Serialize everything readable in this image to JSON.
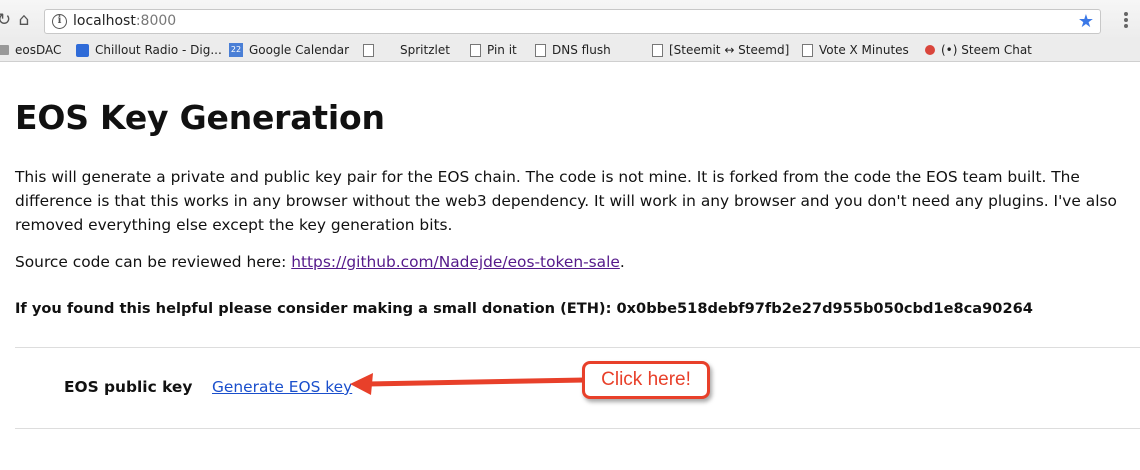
{
  "browser": {
    "url_host": "localhost",
    "url_port": ":8000",
    "bookmarks": [
      {
        "label": "eosDAC",
        "icon": "folder-icon"
      },
      {
        "label": "Chillout Radio - Dig...",
        "icon": "radio-icon"
      },
      {
        "label": "Google Calendar",
        "icon": "calendar-icon",
        "badge": "22"
      },
      {
        "label": "Spritzlet",
        "icon": "page-icon"
      },
      {
        "label": "Pin it",
        "icon": "page-icon"
      },
      {
        "label": "DNS flush",
        "icon": "page-icon"
      },
      {
        "label": "[Steemit ↔ Steemd]",
        "icon": "page-icon"
      },
      {
        "label": "Vote X Minutes",
        "icon": "page-icon"
      },
      {
        "label": "(•) Steem Chat",
        "icon": "chat-icon"
      }
    ]
  },
  "page": {
    "title": "EOS Key Generation",
    "intro": "This will generate a private and public key pair for the EOS chain. The code is not mine. It is forked from the code the EOS team built. The difference is that this works in any browser without the web3 dependency. It will work in any browser and you don't need any plugins. I've also removed everything else except the key generation bits.",
    "source_prefix": "Source code can be reviewed here: ",
    "source_link": "https://github.com/Nadejde/eos-token-sale",
    "source_suffix": ".",
    "donation": "If you found this helpful please consider making a small donation (ETH): 0x0bbe518debf97fb2e27d955b050cbd1e8ca90264",
    "key_label": "EOS public key",
    "generate_link": "Generate EOS key"
  },
  "annotation": {
    "callout": "Click here!",
    "color": "#e8402a"
  }
}
